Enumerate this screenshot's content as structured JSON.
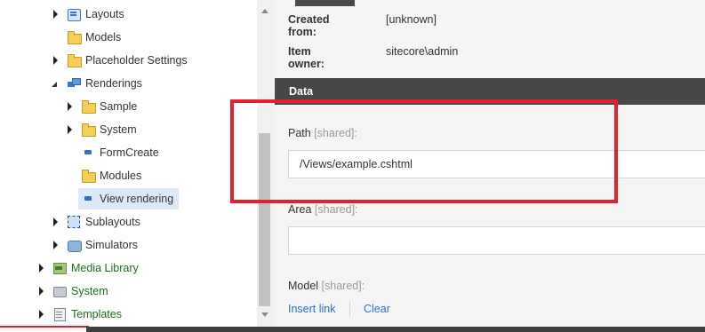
{
  "tree": {
    "items": [
      {
        "label": "Layouts",
        "icon": "layouts-icon",
        "arrow": "right",
        "selected": false,
        "green": false
      },
      {
        "label": "Models",
        "icon": "folder-icon",
        "arrow": "none",
        "selected": false,
        "green": false
      },
      {
        "label": "Placeholder Settings",
        "icon": "folder-icon",
        "arrow": "right",
        "selected": false,
        "green": false
      },
      {
        "label": "Renderings",
        "icon": "renderings-icon",
        "arrow": "down",
        "selected": false,
        "green": false
      },
      {
        "label": "Sample",
        "icon": "folder-icon",
        "arrow": "right",
        "selected": false,
        "green": false
      },
      {
        "label": "System",
        "icon": "folder-icon",
        "arrow": "right",
        "selected": false,
        "green": false
      },
      {
        "label": "FormCreate",
        "icon": "rendering-item-icon",
        "arrow": "none",
        "selected": false,
        "green": false
      },
      {
        "label": "Modules",
        "icon": "folder-icon",
        "arrow": "none",
        "selected": false,
        "green": false
      },
      {
        "label": "View rendering",
        "icon": "rendering-item-icon",
        "arrow": "none",
        "selected": true,
        "green": false
      },
      {
        "label": "Sublayouts",
        "icon": "sublayouts-icon",
        "arrow": "right",
        "selected": false,
        "green": false
      },
      {
        "label": "Simulators",
        "icon": "simulators-icon",
        "arrow": "right",
        "selected": false,
        "green": false
      },
      {
        "label": "Media Library",
        "icon": "media-library-icon",
        "arrow": "right",
        "selected": false,
        "green": true
      },
      {
        "label": "System",
        "icon": "system-icon",
        "arrow": "right",
        "selected": false,
        "green": true
      },
      {
        "label": "Templates",
        "icon": "templates-icon",
        "arrow": "right",
        "selected": false,
        "green": true
      }
    ]
  },
  "editor": {
    "info": {
      "created_from_label": "Created from:",
      "created_from_value": "[unknown]",
      "owner_label": "Item owner:",
      "owner_value": "sitecore\\admin"
    },
    "section_title": "Data",
    "fields": {
      "path_label": "Path",
      "path_shared": "[shared]:",
      "path_value": "/Views/example.cshtml",
      "area_label": "Area",
      "area_shared": "[shared]:",
      "area_value": "",
      "model_label": "Model",
      "model_shared": "[shared]:"
    },
    "links": {
      "insert": "Insert link",
      "clear": "Clear"
    }
  },
  "colors": {
    "highlight": "#e3202e",
    "section_header": "#474747",
    "link": "#2a72c0",
    "tree_green": "#1b6f1b",
    "selected_bg": "#dbeaf6"
  }
}
